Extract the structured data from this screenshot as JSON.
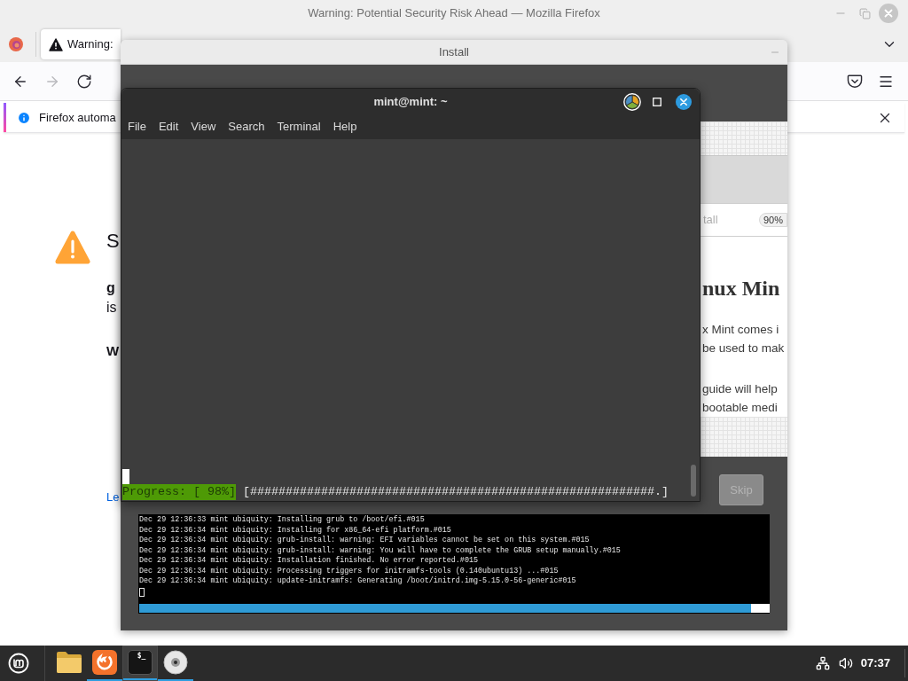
{
  "firefox": {
    "title": "Warning: Potential Security Risk Ahead — Mozilla Firefox",
    "tabs": [
      {
        "label": "Warning:",
        "selected": true
      }
    ],
    "nav": [
      {
        "kind": "back",
        "disabled": false
      },
      {
        "kind": "forward",
        "disabled": true
      },
      {
        "kind": "reload",
        "disabled": false
      }
    ],
    "notification": {
      "text": "Firefox automa"
    },
    "page": {
      "heading": "S",
      "bold_line": "g",
      "line": "is",
      "subheading": "W",
      "link": "Le"
    }
  },
  "installer": {
    "title": "Install",
    "status": {
      "text": "tall",
      "percent": "90%"
    },
    "slide": {
      "heading": "nux Min",
      "paragraphs": [
        [
          "x Mint comes i",
          "be used to mak"
        ],
        [
          "guide will help",
          "bootable medi"
        ]
      ]
    },
    "skip": {
      "label": "Skip",
      "disabled": true
    },
    "log": [
      "Dec 29 12:36:33 mint ubiquity: Installing grub to /boot/efi.#015",
      "Dec 29 12:36:34 mint ubiquity: Installing for x86_64-efi platform.#015",
      "Dec 29 12:36:34 mint ubiquity: grub-install: warning: EFI variables cannot be set on this system.#015",
      "Dec 29 12:36:34 mint ubiquity: grub-install: warning: You will have to complete the GRUB setup manually.#015",
      "Dec 29 12:36:34 mint ubiquity: Installation finished. No error reported.#015",
      "Dec 29 12:36:34 mint ubiquity: Processing triggers for initramfs-tools (0.140ubuntu13) ...#015",
      "Dec 29 12:36:34 mint ubiquity: update-initramfs: Generating /boot/initrd.img-5.15.0-56-generic#015"
    ],
    "progress": {
      "level": 0.97
    }
  },
  "terminal": {
    "title": "mint@mint: ~",
    "menu": [
      "File",
      "Edit",
      "View",
      "Search",
      "Terminal",
      "Help"
    ],
    "progress_label": "Progress: [ 98%]",
    "progress_bar": "[#########################################################.]"
  },
  "taskbar": {
    "apps": [
      {
        "kind": "files",
        "running": false,
        "selected": false
      },
      {
        "kind": "firefox",
        "running": true,
        "selected": false
      },
      {
        "kind": "terminal",
        "glyph": "$_",
        "running": true,
        "selected": true
      },
      {
        "kind": "disc",
        "running": true,
        "selected": false
      }
    ],
    "clock": "07:37"
  }
}
